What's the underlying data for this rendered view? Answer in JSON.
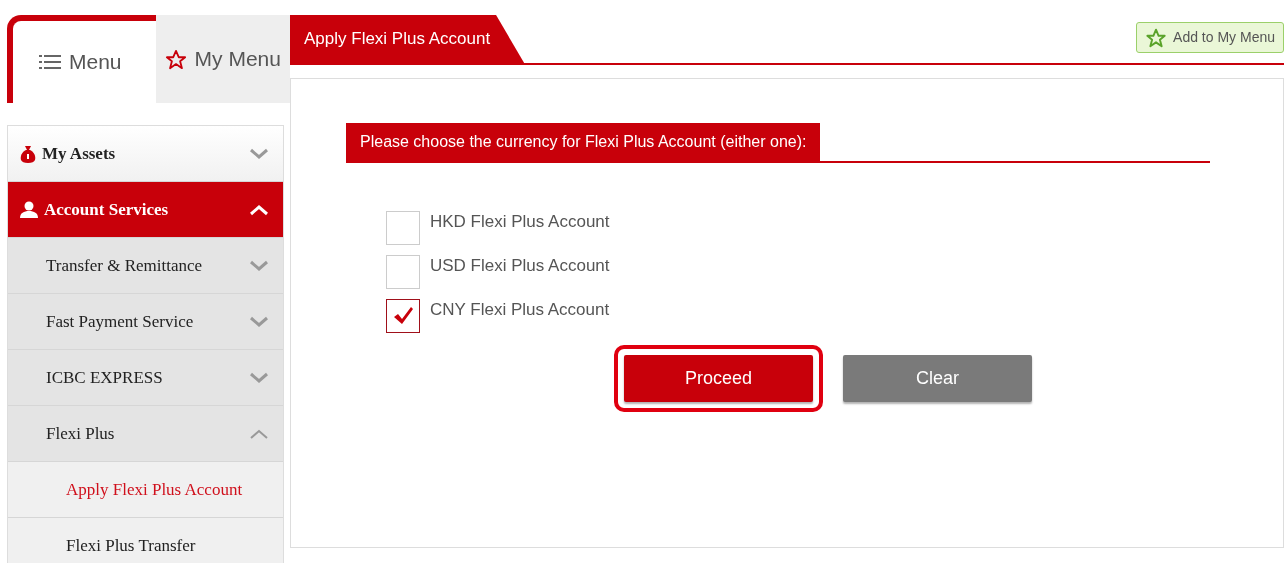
{
  "menu_tabs": [
    {
      "label": "Menu",
      "selected": true
    },
    {
      "label": "My Menu",
      "selected": false
    }
  ],
  "sidebar": {
    "items": [
      {
        "label": "My Assets",
        "expanded": false,
        "selected": false
      },
      {
        "label": "Account Services",
        "expanded": true,
        "selected": true,
        "children": [
          {
            "label": "Transfer & Remittance",
            "expanded": false
          },
          {
            "label": "Fast Payment Service",
            "expanded": false
          },
          {
            "label": "ICBC EXPRESS",
            "expanded": false
          },
          {
            "label": "Flexi Plus",
            "expanded": true,
            "children": [
              {
                "label": "Apply Flexi Plus Account",
                "selected": true
              },
              {
                "label": "Flexi Plus Transfer",
                "selected": false
              }
            ]
          }
        ]
      }
    ]
  },
  "page": {
    "title": "Apply Flexi Plus Account",
    "add_button": "Add to My Menu",
    "section_title": "Please choose the currency for Flexi Plus Account (either one):",
    "options": [
      {
        "label": "HKD Flexi Plus Account",
        "checked": false
      },
      {
        "label": "USD Flexi Plus Account",
        "checked": false
      },
      {
        "label": "CNY Flexi Plus Account",
        "checked": true
      }
    ],
    "buttons": [
      {
        "label": "Proceed",
        "kind": "primary",
        "highlighted": true
      },
      {
        "label": "Clear",
        "kind": "secondary",
        "highlighted": false
      }
    ]
  }
}
